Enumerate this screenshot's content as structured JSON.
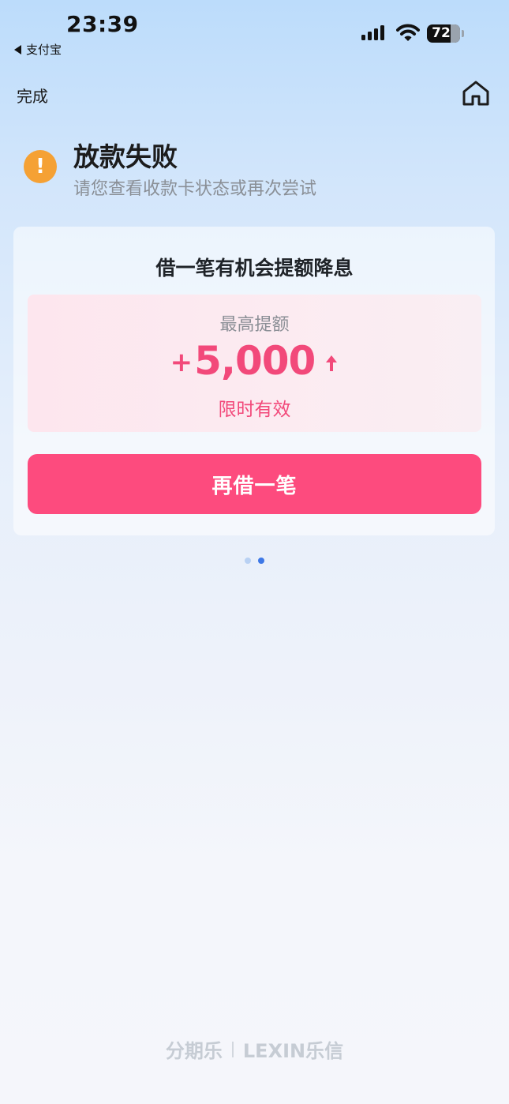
{
  "status_bar": {
    "time": "23:39",
    "back_app": "支付宝",
    "battery": "72",
    "battery_level": 0.72
  },
  "nav": {
    "done_label": "完成",
    "home_icon": "home-icon"
  },
  "result": {
    "icon": "warning-icon",
    "icon_glyph": "!",
    "title": "放款失败",
    "subtitle": "请您查看收款卡状态或再次尝试"
  },
  "promo_card": {
    "title": "借一笔有机会提额降息",
    "label": "最高提额",
    "plus": "+",
    "amount": "5,000",
    "note": "限时有效",
    "button_label": "再借一笔"
  },
  "pager": {
    "count": 2,
    "active_index": 1
  },
  "footer": {
    "brand_left": "分期乐",
    "brand_right": "LEXIN乐信"
  },
  "colors": {
    "accent": "#fd4b7e",
    "amount": "#f2497a",
    "warning": "#f5a134",
    "pager_active": "#3e78e6"
  }
}
